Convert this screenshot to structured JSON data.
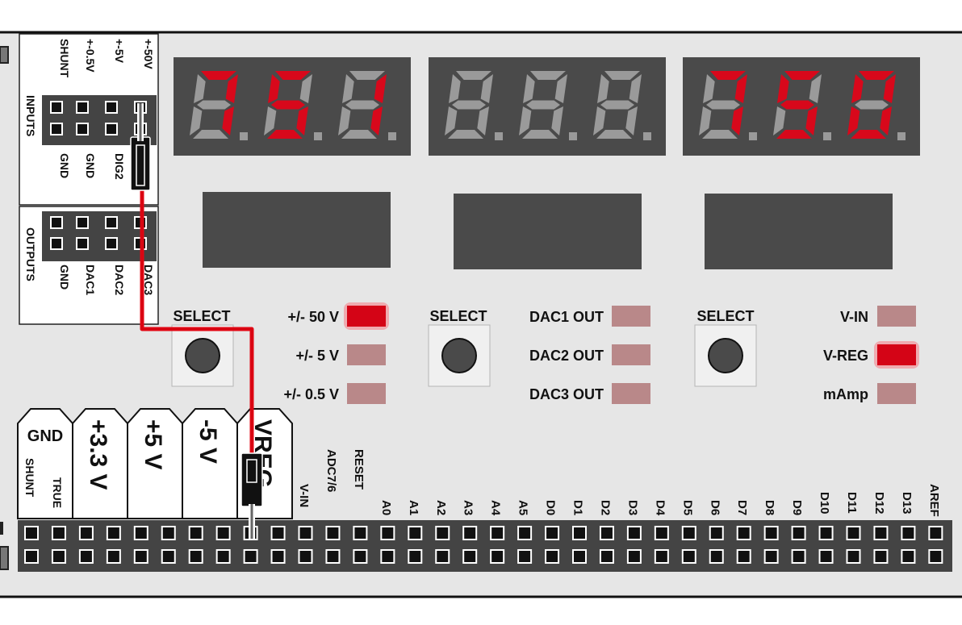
{
  "inputs": {
    "title": "INPUTS",
    "labels": [
      "SHUNT",
      "+-0.5V",
      "+-5V",
      "+-50V"
    ],
    "bottom_labels": [
      "GND",
      "GND",
      "DIG2"
    ]
  },
  "outputs": {
    "title": "OUTPUTS",
    "labels": [
      "GND",
      "DAC1",
      "DAC2",
      "DAC3"
    ]
  },
  "displays": [
    {
      "digits": [
        "7",
        "5",
        "1"
      ],
      "lit": [
        true,
        true,
        true
      ]
    },
    {
      "digits": [
        "8",
        "8",
        "8"
      ],
      "lit": [
        false,
        false,
        false
      ]
    },
    {
      "digits": [
        "7",
        "5",
        "0"
      ],
      "lit": [
        true,
        true,
        true
      ]
    }
  ],
  "panels": [
    {
      "select_label": "SELECT",
      "leds": [
        {
          "label": "+/- 50 V",
          "on": true
        },
        {
          "label": "+/- 5 V",
          "on": false
        },
        {
          "label": "+/- 0.5 V",
          "on": false
        }
      ]
    },
    {
      "select_label": "SELECT",
      "leds": [
        {
          "label": "DAC1 OUT",
          "on": false
        },
        {
          "label": "DAC2 OUT",
          "on": false
        },
        {
          "label": "DAC3 OUT",
          "on": false
        }
      ]
    },
    {
      "select_label": "SELECT",
      "leds": [
        {
          "label": "V-IN",
          "on": false
        },
        {
          "label": "V-REG",
          "on": true
        },
        {
          "label": "mAmp",
          "on": false
        }
      ]
    }
  ],
  "power": {
    "gnd": "GND",
    "shunt": "SHUNT",
    "true": "TRUE",
    "boxes": [
      "+3.3 V",
      "+5 V",
      "-5 V",
      "VREG"
    ]
  },
  "header_labels": [
    "V-IN",
    "ADC7/6",
    "RESET",
    "A0",
    "A1",
    "A2",
    "A3",
    "A4",
    "A5",
    "D0",
    "D1",
    "D2",
    "D3",
    "D4",
    "D5",
    "D6",
    "D7",
    "D8",
    "D9",
    "D10",
    "D11",
    "D12",
    "D13",
    "AREF"
  ],
  "colors": {
    "board": "#e6e6e6",
    "display_bg": "#4a4a4a",
    "segment_on": "#d8081b",
    "segment_off": "#9a9a9a",
    "led_on": "#d40416",
    "led_off": "#b98889",
    "wire": "#e30613"
  }
}
